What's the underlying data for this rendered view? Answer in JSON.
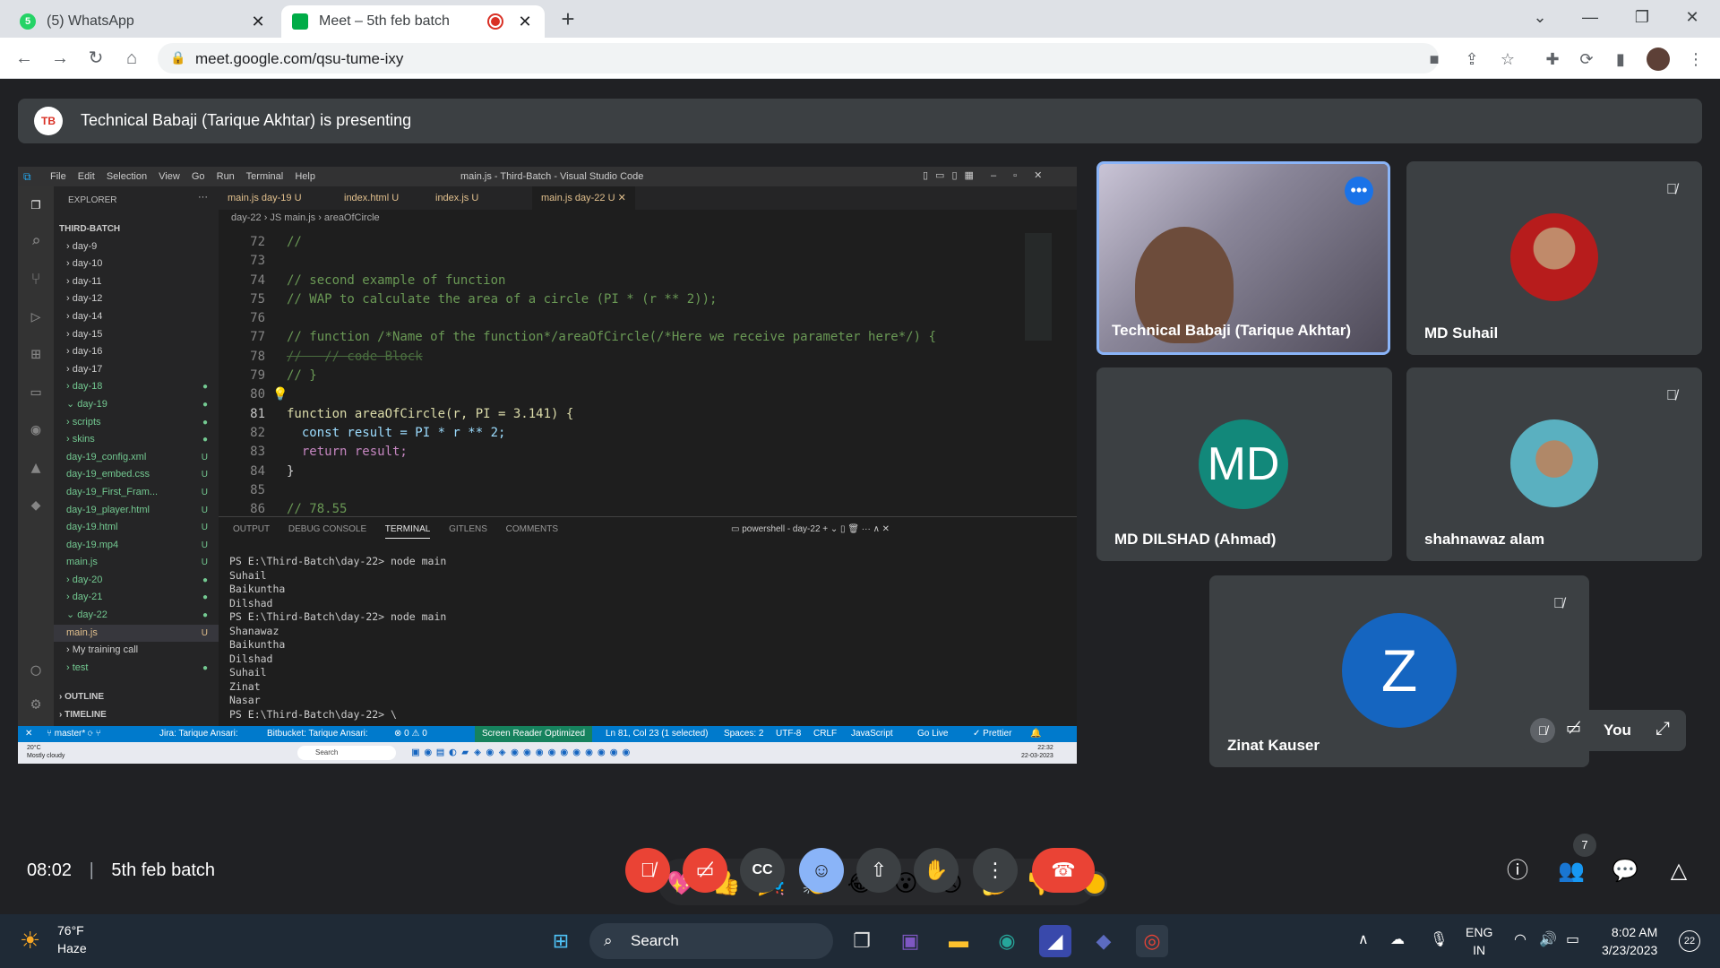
{
  "browser": {
    "tabs": [
      {
        "title": "(5) WhatsApp",
        "badge": "5"
      },
      {
        "title": "Meet – 5th feb batch"
      }
    ],
    "url": "meet.google.com/qsu-tume-ixy"
  },
  "meet": {
    "presenter_banner": "Technical Babaji (Tarique Akhtar) is presenting",
    "presenter_logo": "TB",
    "meeting_time": "08:02",
    "meeting_name": "5th feb batch",
    "participant_count": "7",
    "participants": [
      {
        "name": "Technical Babaji (Tarique Akhtar)"
      },
      {
        "name": "MD Suhail"
      },
      {
        "name": "MD DILSHAD (Ahmad)",
        "initials": "MD"
      },
      {
        "name": "shahnawaz alam"
      },
      {
        "name": "Zinat Kauser",
        "initials": "Z"
      }
    ],
    "self_label": "You",
    "reactions": [
      "💖",
      "👍",
      "🎉",
      "👏",
      "😂",
      "😮",
      "😢",
      "🤔",
      "👎"
    ],
    "colors": {
      "danger": "#ea4335",
      "active": "#8ab4f8",
      "tile": "#3c4043",
      "bg": "#202124",
      "md_avatar": "#12887a",
      "z_avatar": "#1565c0"
    }
  },
  "vscode": {
    "title": "main.js - Third-Batch - Visual Studio Code",
    "menu": [
      "File",
      "Edit",
      "Selection",
      "View",
      "Go",
      "Run",
      "Terminal",
      "Help"
    ],
    "explorer_header": "EXPLORER",
    "tree": [
      {
        "label": "THIRD-BATCH",
        "status": ""
      },
      {
        "label": "› day-9",
        "status": ""
      },
      {
        "label": "› day-10",
        "status": ""
      },
      {
        "label": "› day-11",
        "status": ""
      },
      {
        "label": "› day-12",
        "status": ""
      },
      {
        "label": "› day-14",
        "status": ""
      },
      {
        "label": "› day-15",
        "status": ""
      },
      {
        "label": "› day-16",
        "status": ""
      },
      {
        "label": "› day-17",
        "status": ""
      },
      {
        "label": "› day-18",
        "status": "●"
      },
      {
        "label": "⌄ day-19",
        "status": "●"
      },
      {
        "label": "   › scripts",
        "status": "●"
      },
      {
        "label": "   › skins",
        "status": "●"
      },
      {
        "label": "   day-19_config.xml",
        "status": "U"
      },
      {
        "label": "   day-19_embed.css",
        "status": "U"
      },
      {
        "label": "   day-19_First_Fram...",
        "status": "U"
      },
      {
        "label": "   day-19_player.html",
        "status": "U"
      },
      {
        "label": "   day-19.html",
        "status": "U"
      },
      {
        "label": "   day-19.mp4",
        "status": "U"
      },
      {
        "label": "   main.js",
        "status": "U"
      },
      {
        "label": "› day-20",
        "status": "●"
      },
      {
        "label": "› day-21",
        "status": "●"
      },
      {
        "label": "⌄ day-22",
        "status": "●"
      },
      {
        "label": "   main.js",
        "status": "U"
      },
      {
        "label": "› My training call",
        "status": ""
      },
      {
        "label": "› test",
        "status": "●"
      }
    ],
    "outline": "OUTLINE",
    "timeline": "TIMELINE",
    "tabs": [
      "main.js day-19 U",
      "index.html U",
      "index.js U",
      "main.js day-22 U"
    ],
    "breadcrumb": "day-22 › JS main.js › areaOfCircle",
    "code": [
      {
        "n": "72",
        "t": "//"
      },
      {
        "n": "73",
        "t": ""
      },
      {
        "n": "74",
        "t": "// second example of function"
      },
      {
        "n": "75",
        "t": "// WAP to calculate the area of a circle (PI * (r ** 2));"
      },
      {
        "n": "76",
        "t": ""
      },
      {
        "n": "77",
        "t": "// function /*Name of the function*/areaOfCircle(/*Here we receive parameter here*/) {"
      },
      {
        "n": "78",
        "t": "//   // code Block"
      },
      {
        "n": "79",
        "t": "// }"
      },
      {
        "n": "80",
        "t": ""
      },
      {
        "n": "81",
        "t": "function areaOfCircle(r, PI = 3.141) {"
      },
      {
        "n": "82",
        "t": "  const result = PI * r ** 2;"
      },
      {
        "n": "83",
        "t": "  return result;"
      },
      {
        "n": "84",
        "t": "}"
      },
      {
        "n": "85",
        "t": ""
      },
      {
        "n": "86",
        "t": "// 78.55"
      }
    ],
    "panel_tabs": [
      "OUTPUT",
      "DEBUG CONSOLE",
      "TERMINAL",
      "GITLENS",
      "COMMENTS"
    ],
    "terminal_name": "powershell - day-22",
    "terminal": [
      "PS E:\\Third-Batch\\day-22> node main",
      "Suhail",
      "Baikuntha",
      "Dilshad",
      "PS E:\\Third-Batch\\day-22> node main",
      "Shanawaz",
      "Baikuntha",
      "Dilshad",
      "Suhail",
      "Zinat",
      "Nasar",
      "PS E:\\Third-Batch\\day-22> \\"
    ],
    "status": {
      "branch": "master*",
      "jira": "Jira: Tarique Ansari:",
      "bitbucket": "Bitbucket: Tarique Ansari:",
      "problems": "⊗ 0 ⚠ 0",
      "screen_reader": "Screen Reader Optimized",
      "position": "Ln 81, Col 23 (1 selected)",
      "spaces": "Spaces: 2",
      "encoding": "UTF-8",
      "eol": "CRLF",
      "language": "JavaScript",
      "golive": "Go Live",
      "prettier": "Prettier"
    },
    "inner_taskbar": {
      "weather": "20°C",
      "weather_desc": "Mostly cloudy",
      "search": "Search",
      "time": "22:32",
      "date": "22-03-2023"
    }
  },
  "windows": {
    "weather_temp": "76°F",
    "weather_desc": "Haze",
    "search": "Search",
    "lang": "ENG",
    "region": "IN",
    "time": "8:02 AM",
    "date": "3/23/2023",
    "notifications": "22"
  }
}
